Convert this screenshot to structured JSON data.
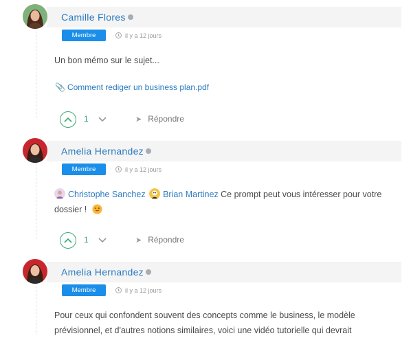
{
  "comments": [
    {
      "author": "Camille Flores",
      "role": "Membre",
      "time": "il y a 12 jours",
      "text": "Un bon mémo sur le sujet...",
      "attachment": "Comment rediger un business plan.pdf",
      "votes": "1",
      "reply_label": "Répondre"
    },
    {
      "author": "Amelia Hernandez",
      "role": "Membre",
      "time": "il y a 12 jours",
      "mention1": "Christophe Sanchez",
      "mention2": "Brian Martinez",
      "text_after": "Ce prompt peut vous intéresser pour votre dossier !",
      "votes": "1",
      "reply_label": "Répondre"
    },
    {
      "author": "Amelia Hernandez",
      "role": "Membre",
      "time": "il y a 12 jours",
      "text": "Pour ceux qui confondent souvent des concepts comme le business, le modèle prévisionnel, et d'autres notions similaires, voici une vidéo tutorielle qui devrait"
    }
  ],
  "colors": {
    "accent": "#2a7ac0",
    "badge": "#1a8ee8",
    "vote": "#3aa873",
    "online_dot": "#a7adb4"
  }
}
